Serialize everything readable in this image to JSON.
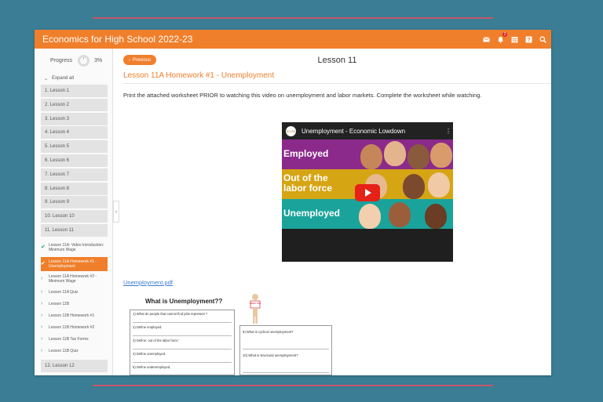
{
  "app": {
    "title": "Economics for High School 2022-23",
    "notification_count": "2",
    "icons": [
      "mail-icon",
      "bell-icon",
      "calendar-icon",
      "help-icon",
      "search-icon"
    ]
  },
  "sidebar": {
    "progress_label": "Progress",
    "progress_value": "3%",
    "progress_fraction": 0.03,
    "expand_all": "Expand all",
    "lessons": [
      "1. Lesson 1",
      "2. Lesson 2",
      "3. Lesson 3",
      "4. Lesson 4",
      "5. Lesson 5",
      "6. Lesson 6",
      "7. Lesson 7",
      "8. Lesson 8",
      "9. Lesson 9",
      "10. Lesson 10",
      "11. Lesson 11"
    ],
    "sub_items": [
      {
        "label": "Lesson 11A: Video Introduction: Minimum Wage",
        "status": "check"
      },
      {
        "label": "Lesson 11A Homework #1 - Unemployment",
        "status": "active"
      },
      {
        "label": "Lesson 11A Homework #2 - Minimum Wage",
        "status": "chevron"
      },
      {
        "label": "Lesson 11A Quiz",
        "status": "chevron"
      },
      {
        "label": "Lesson 11B",
        "status": "chevron"
      },
      {
        "label": "Lesson 11B Homework #1",
        "status": "chevron"
      },
      {
        "label": "Lesson 11B Homework #2",
        "status": "chevron"
      },
      {
        "label": "Lesson 11B Tax Forms",
        "status": "chevron"
      },
      {
        "label": "Lesson 11B Quiz",
        "status": "chevron"
      }
    ],
    "next_lesson": "12. Lesson 12"
  },
  "content": {
    "prev_label": "Previous",
    "lesson_title": "Lesson 11",
    "assignment_title": "Lesson 11A Homework #1 - Unemployment",
    "instructions": "Print the attached worksheet PRIOR to watching this video on unemployment and labor markets.  Complete the worksheet while watching.",
    "video": {
      "title": "Unemployment - Economic Lowdown",
      "logo_text": "ECON",
      "band_1": "Employed",
      "band_2": "Out of the labor force",
      "band_3": "Unemployed"
    },
    "pdf_link": "Unemployment.pdf",
    "worksheet": {
      "title": "What is Unemployment??",
      "sign_text": "NEED JOB",
      "left_questions": [
        "1)  What do people that cannot find jobs represent ?",
        "2) Define employed.",
        "3) Define: out of the labor force'",
        "4) Define unemployed.",
        "5) Define underemployed."
      ],
      "right_questions": [
        "9)  What is cyclical unemployment?",
        "10) What is structural unemployment?"
      ]
    }
  },
  "colors": {
    "background": "#3a7d94",
    "accent": "#f07f2b",
    "decor_line": "#c4556a",
    "link": "#3a7bd5"
  }
}
